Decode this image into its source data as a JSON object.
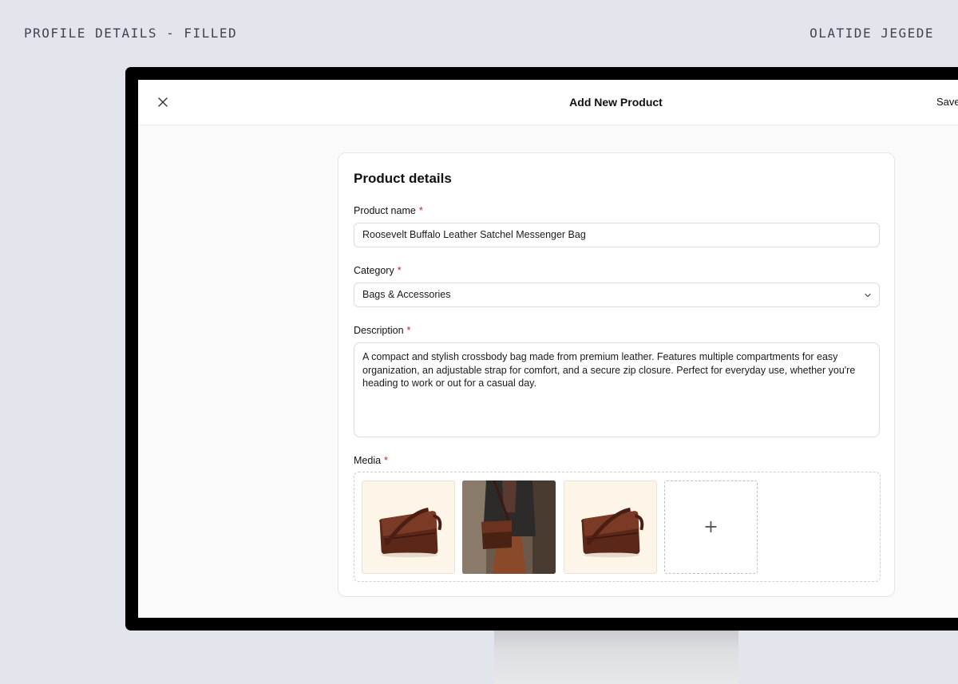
{
  "captions": {
    "left": "PROFILE DETAILS - FILLED",
    "right": "OLATIDE JEGEDE"
  },
  "modal": {
    "title": "Add New Product",
    "save_label": "Save",
    "close_icon": "close-icon"
  },
  "card": {
    "title": "Product details"
  },
  "fields": {
    "required_marker": "*",
    "product_name": {
      "label": "Product name",
      "value": "Roosevelt Buffalo Leather Satchel Messenger Bag"
    },
    "category": {
      "label": "Category",
      "value": "Bags & Accessories",
      "icon": "chevron-down-icon"
    },
    "description": {
      "label": "Description",
      "value": "A compact and stylish crossbody bag made from premium leather. Features multiple compartments for easy organization, an adjustable strap for comfort, and a secure zip closure. Perfect for everyday use, whether you're heading to work or out for a casual day."
    },
    "media": {
      "label": "Media",
      "add_label": "+",
      "items": [
        {
          "kind": "product-photo",
          "icon": "leather-bag-image"
        },
        {
          "kind": "lifestyle-photo",
          "icon": "person-with-bag-image"
        },
        {
          "kind": "product-photo",
          "icon": "leather-bag-image"
        }
      ]
    }
  },
  "colors": {
    "background": "#e2e5ec",
    "required": "#d21f1f",
    "thumb_cream": "#fdf6e8",
    "leather": "#5e2a1c"
  }
}
